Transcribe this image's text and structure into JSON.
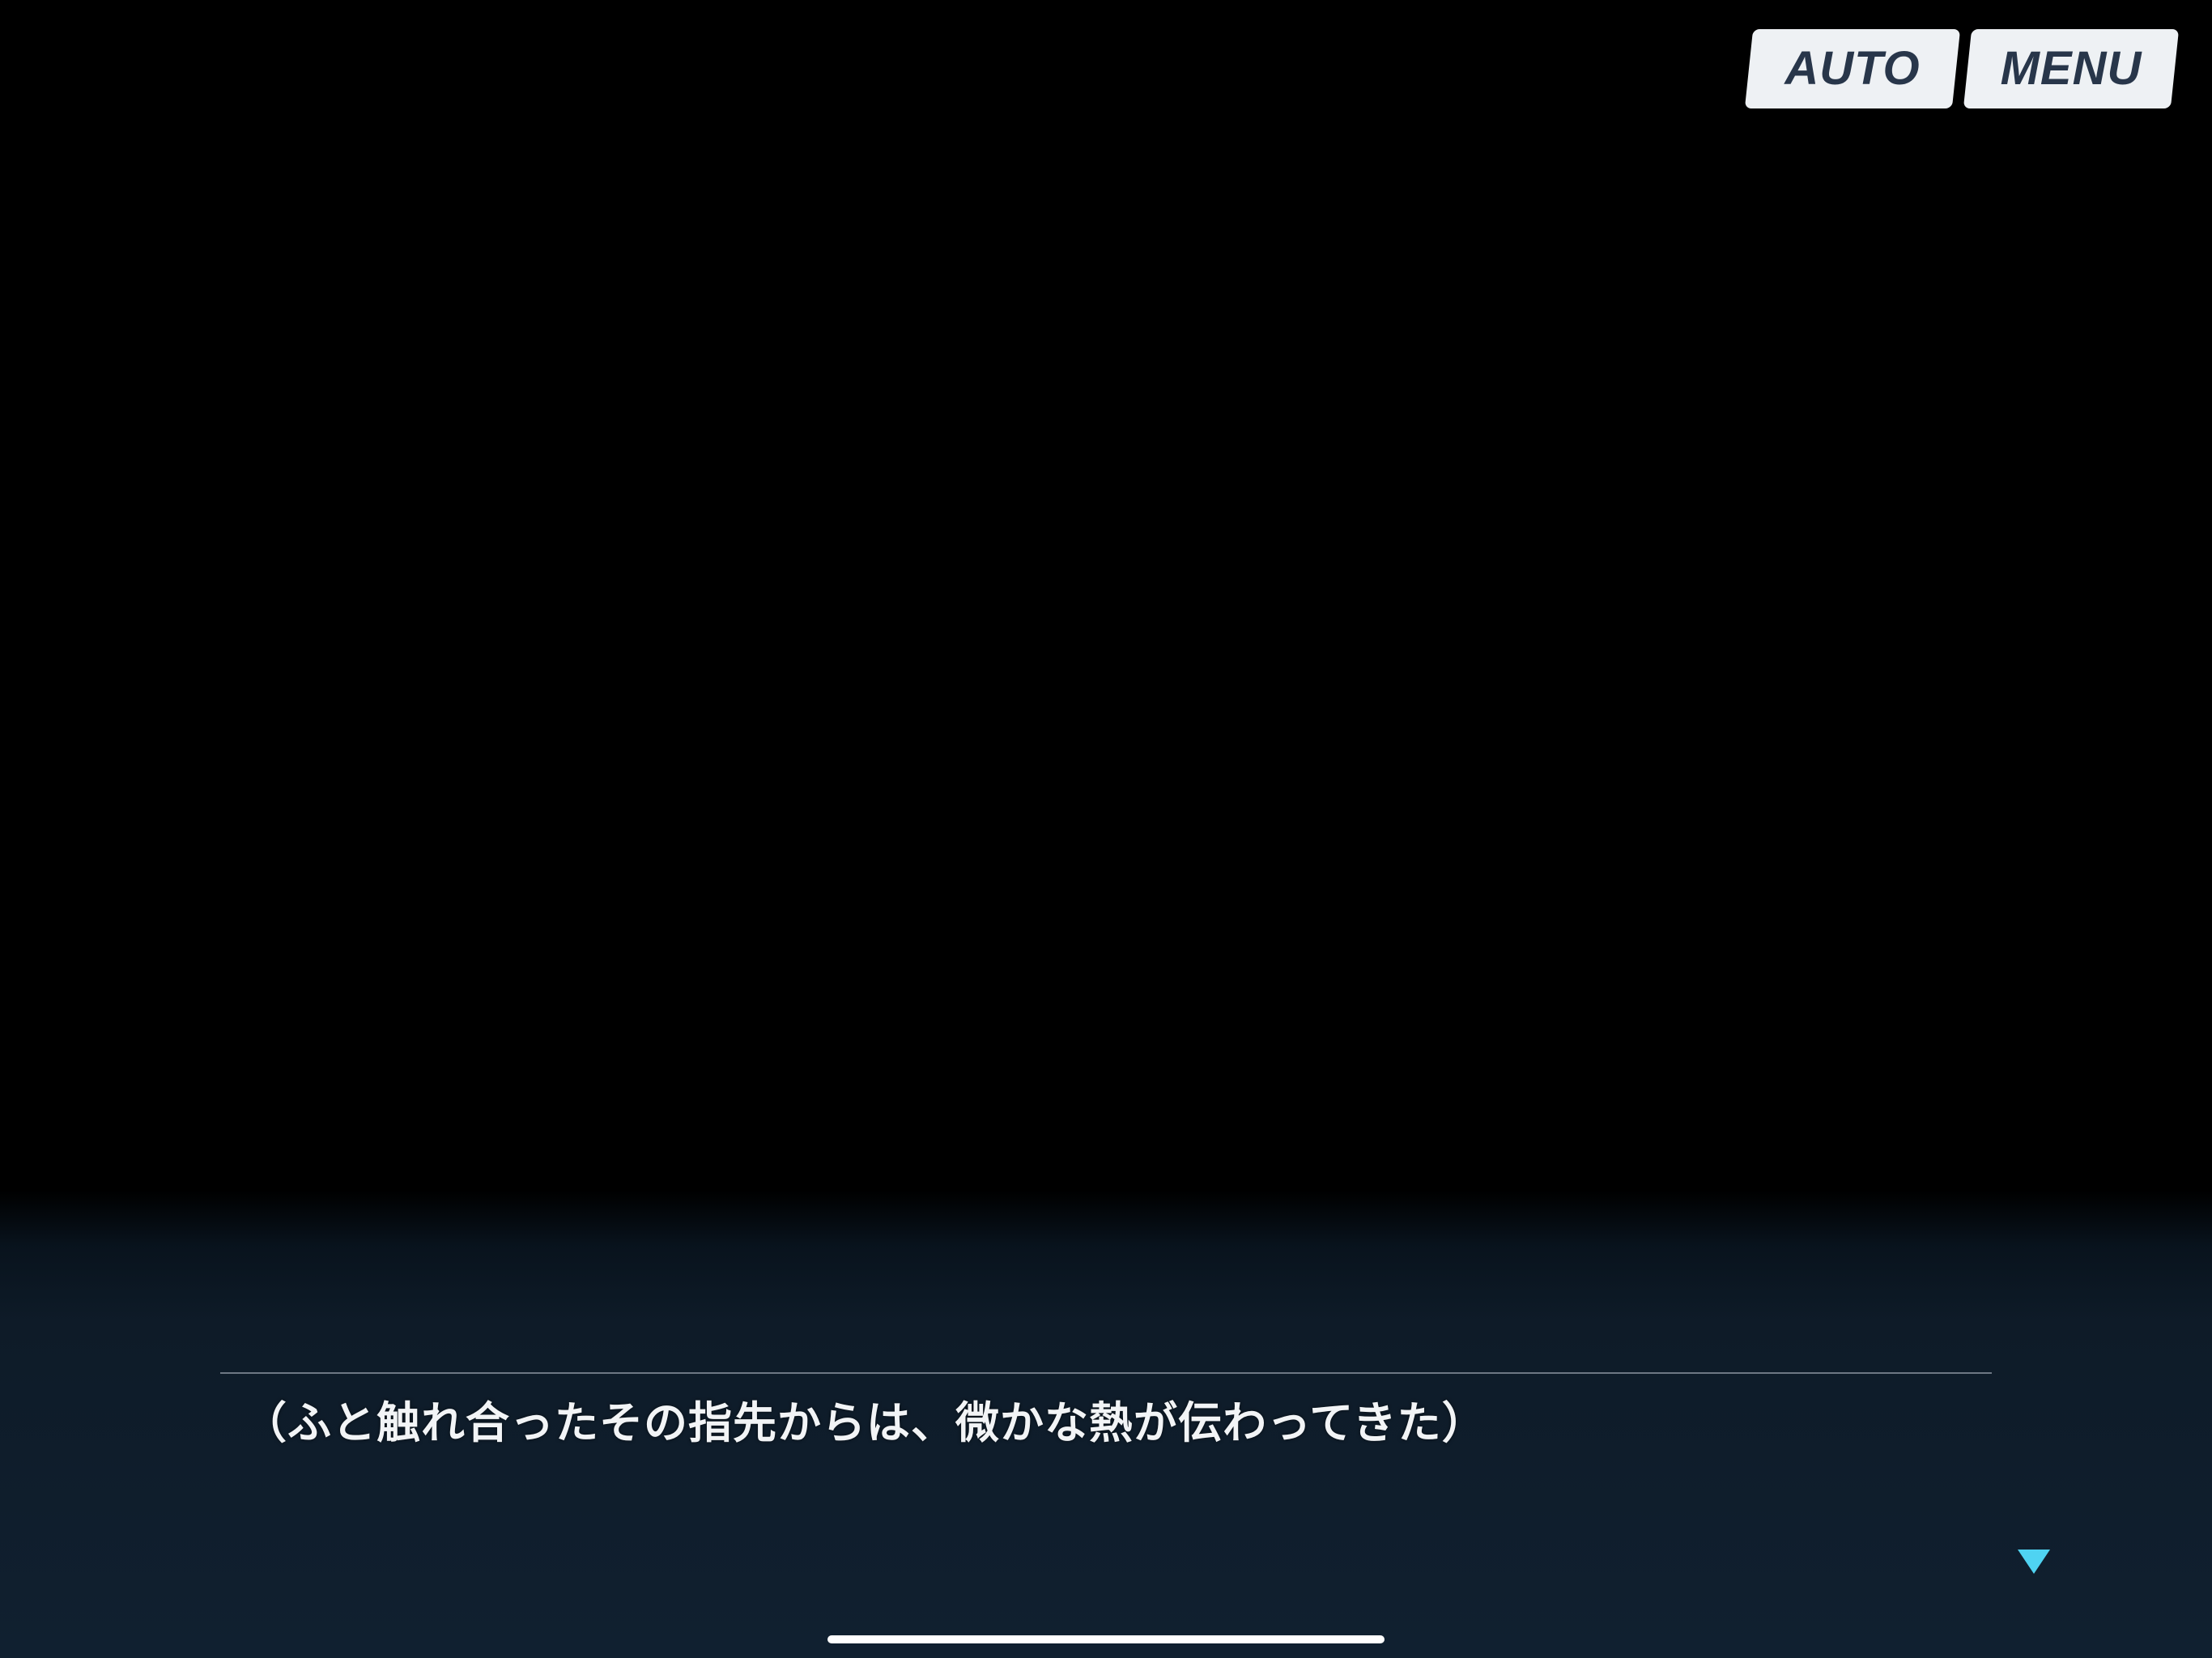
{
  "toolbar": {
    "auto_label": "AUTO",
    "menu_label": "MENU"
  },
  "dialogue": {
    "text": "（ふと触れ合ったその指先からは、微かな熱が伝わってきた）",
    "advance_icon": "triangle-down-icon"
  },
  "colors": {
    "panel": "#0e1b28",
    "button_bg": "#eef1f4",
    "button_text": "#28364a",
    "advance_indicator": "#4fd3f2",
    "text": "#f2f4f6"
  }
}
